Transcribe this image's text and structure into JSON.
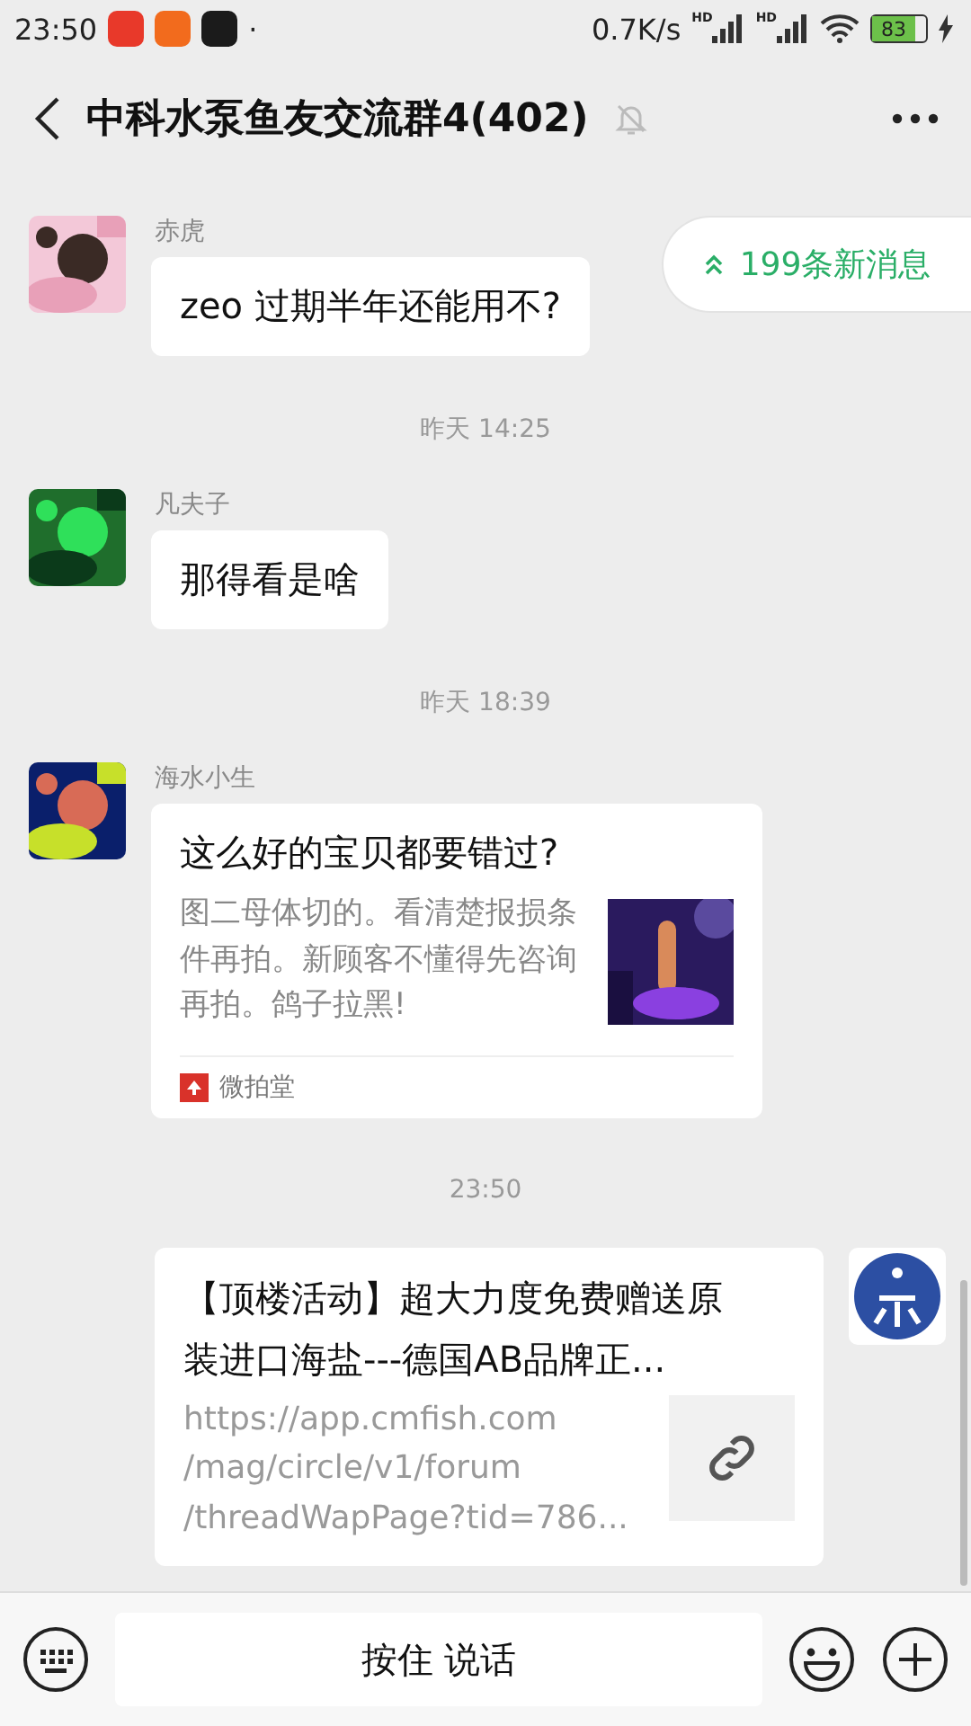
{
  "status_bar": {
    "time": "23:50",
    "dot": "·",
    "speed": "0.7K/s",
    "signal_labels": [
      "HD",
      "HD"
    ],
    "battery": "83"
  },
  "header": {
    "title": "中科水泵鱼友交流群4(402)",
    "muted": true
  },
  "new_messages": {
    "label": "199条新消息"
  },
  "messages": [
    {
      "kind": "text",
      "sender": "赤虎",
      "text": "zeo 过期半年还能用不?"
    },
    {
      "kind": "time",
      "text": "昨天 14:25"
    },
    {
      "kind": "text",
      "sender": "凡夫子",
      "text": "那得看是啥"
    },
    {
      "kind": "time",
      "text": "昨天 18:39"
    },
    {
      "kind": "card",
      "sender": "海水小生",
      "title": "这么好的宝贝都要错过?",
      "description": "图二母体切的。看清楚报损条件再拍。新顾客不懂得先咨询再拍。鸽子拉黑!",
      "source": "微拍堂"
    },
    {
      "kind": "time",
      "text": "23:50"
    },
    {
      "kind": "link",
      "title_lines": [
        "【顶楼活动】超大力度免费赠送原",
        "装进口海盐---德国AB品牌正..."
      ],
      "url_lines": [
        "https://app.cmfish.com",
        "/mag/circle/v1/forum",
        "/threadWapPage?tid=786..."
      ]
    }
  ],
  "input": {
    "label": "按住 说话"
  }
}
